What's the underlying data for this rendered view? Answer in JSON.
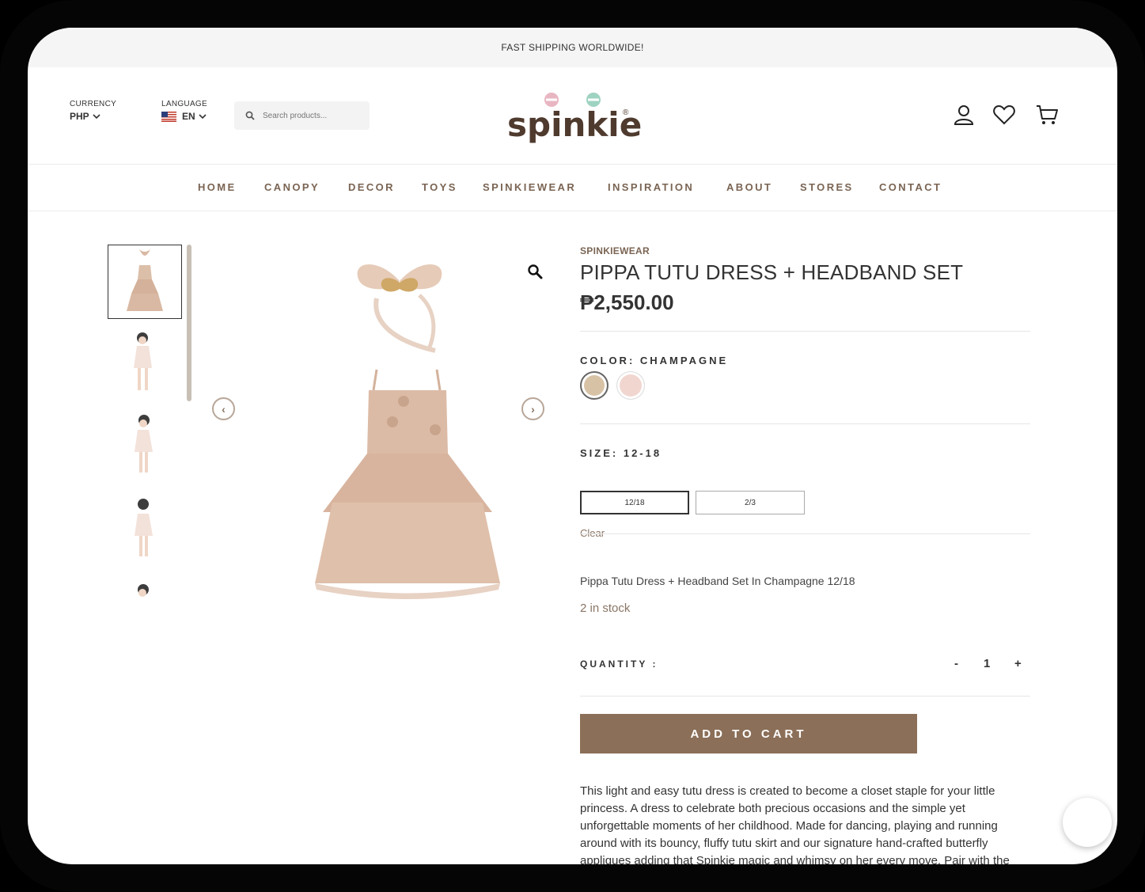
{
  "announcement": "FAST SHIPPING WORLDWIDE!",
  "header": {
    "currency_label": "CURRENCY",
    "currency_value": "PHP",
    "language_label": "LANGUAGE",
    "language_value": "EN",
    "search_placeholder": "Search products...",
    "logo_text": "spinkie",
    "logo_mark": "®"
  },
  "nav": [
    "HOME",
    "CANOPY",
    "DECOR",
    "TOYS",
    "SPINKIEWEAR",
    "INSPIRATION",
    "ABOUT",
    "STORES",
    "CONTACT"
  ],
  "gallery": {
    "prev_arrow": "‹",
    "next_arrow": "›"
  },
  "product": {
    "category": "SPINKIEWEAR",
    "title": "PIPPA TUTU DRESS + HEADBAND SET",
    "price": "₱2,550.00",
    "color_label": "COLOR: CHAMPAGNE",
    "colors": [
      "#d8c2a6",
      "#f1d6d0"
    ],
    "size_label": "SIZE: 12-18",
    "sizes": [
      "12/18",
      "2/3"
    ],
    "clear": "Clear",
    "variation_name": "Pippa Tutu Dress + Headband Set In Champagne 12/18",
    "stock": "2 in stock",
    "quantity_label": "QUANTITY :",
    "qty_minus": "-",
    "qty_value": "1",
    "qty_plus": "+",
    "add_to_cart": "ADD TO CART",
    "description": "This light and easy tutu dress is created to become a closet staple for your little princess. A dress to celebrate both precious occasions and the simple yet unforgettable moments of her childhood. Made for dancing, playing and running around with its bouncy, fluffy tutu skirt and our signature hand-crafted butterfly appliques adding that Spinkie magic and whimsy on her every move. Pair with the Pippa Butterfly Headband to complete this"
  },
  "colors": {
    "accent": "#8b6f58",
    "nav_text": "#7a6453",
    "dress": "#d9b9a3"
  }
}
